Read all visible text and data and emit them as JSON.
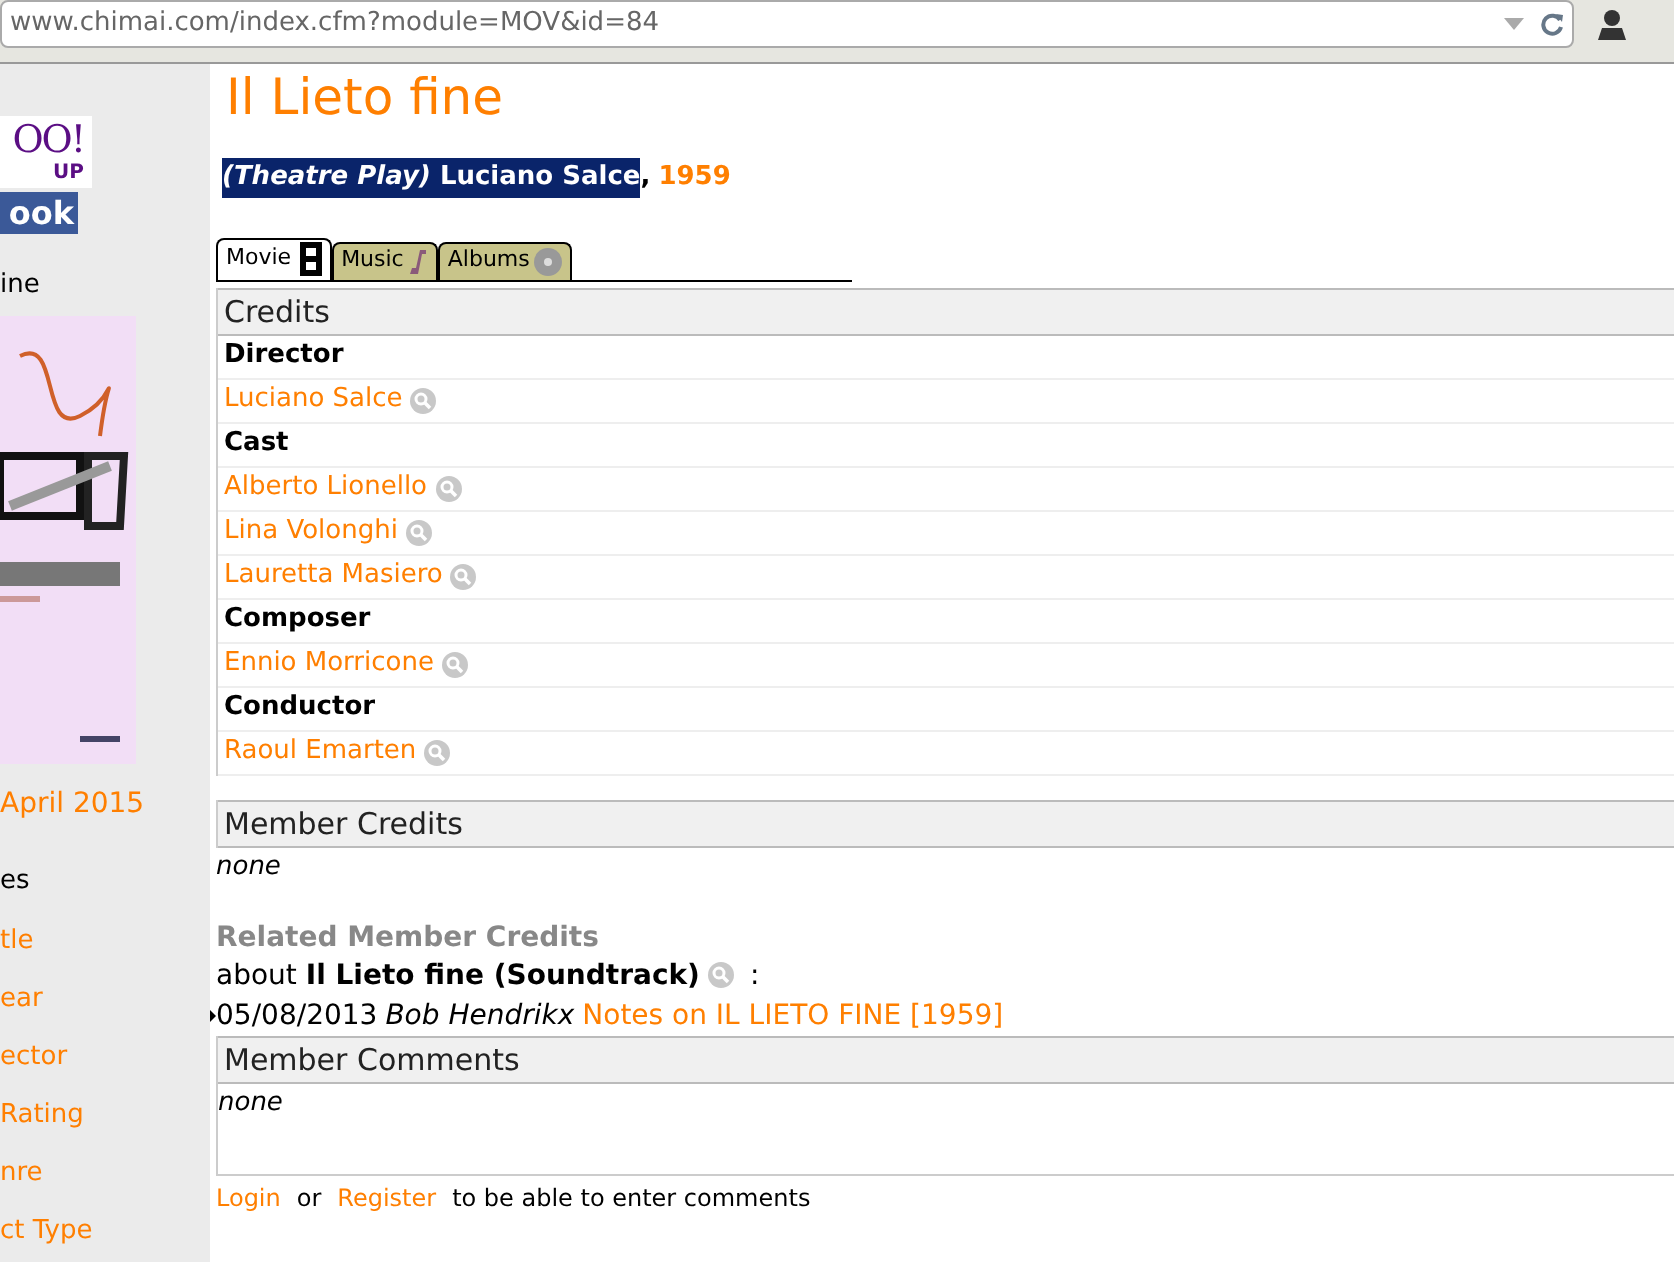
{
  "address_bar": {
    "url": "www.chimai.com/index.cfm?module=MOV&id=84"
  },
  "sidebar": {
    "logo_top": "OO!",
    "logo_sub": "UP",
    "logo_social": "ook",
    "magazine_label": "ine",
    "issue_link": "April 2015",
    "browse_label": "es",
    "links": [
      "tle",
      "ear",
      "ector",
      "Rating",
      "nre",
      "ct Type"
    ]
  },
  "title": "Il Lieto fine",
  "subtitle": {
    "type_label": "(Theatre Play)",
    "director": "Luciano Salce",
    "selected": true,
    "separator": ",",
    "year": "1959"
  },
  "tabs": [
    {
      "label": "Movie",
      "kind": "film",
      "selected": true
    },
    {
      "label": "Music",
      "kind": "note",
      "selected": false
    },
    {
      "label": "Albums",
      "kind": "disc",
      "selected": false
    }
  ],
  "credits": {
    "heading": "Credits",
    "rows": [
      {
        "kind": "role",
        "text": "Director"
      },
      {
        "kind": "person",
        "text": "Luciano Salce"
      },
      {
        "kind": "role",
        "text": "Cast"
      },
      {
        "kind": "person",
        "text": "Alberto Lionello"
      },
      {
        "kind": "person",
        "text": "Lina Volonghi"
      },
      {
        "kind": "person",
        "text": "Lauretta Masiero"
      },
      {
        "kind": "role",
        "text": "Composer"
      },
      {
        "kind": "person",
        "text": "Ennio Morricone"
      },
      {
        "kind": "role",
        "text": "Conductor"
      },
      {
        "kind": "person",
        "text": "Raoul Emarten"
      }
    ]
  },
  "member_credits": {
    "heading": "Member Credits",
    "value": "none"
  },
  "related": {
    "heading": "Related Member Credits",
    "about": "about",
    "subject": "Il Lieto fine (Soundtrack)",
    "colon": ":",
    "entries": [
      {
        "date": "05/08/2013",
        "author": "Bob Hendrikx",
        "link": "Notes on IL LIETO FINE [1959]"
      }
    ]
  },
  "member_comments": {
    "heading": "Member Comments",
    "value": "none"
  },
  "footer": {
    "login": "Login",
    "or": "or",
    "register": "Register",
    "rest": "to be able to enter comments"
  }
}
